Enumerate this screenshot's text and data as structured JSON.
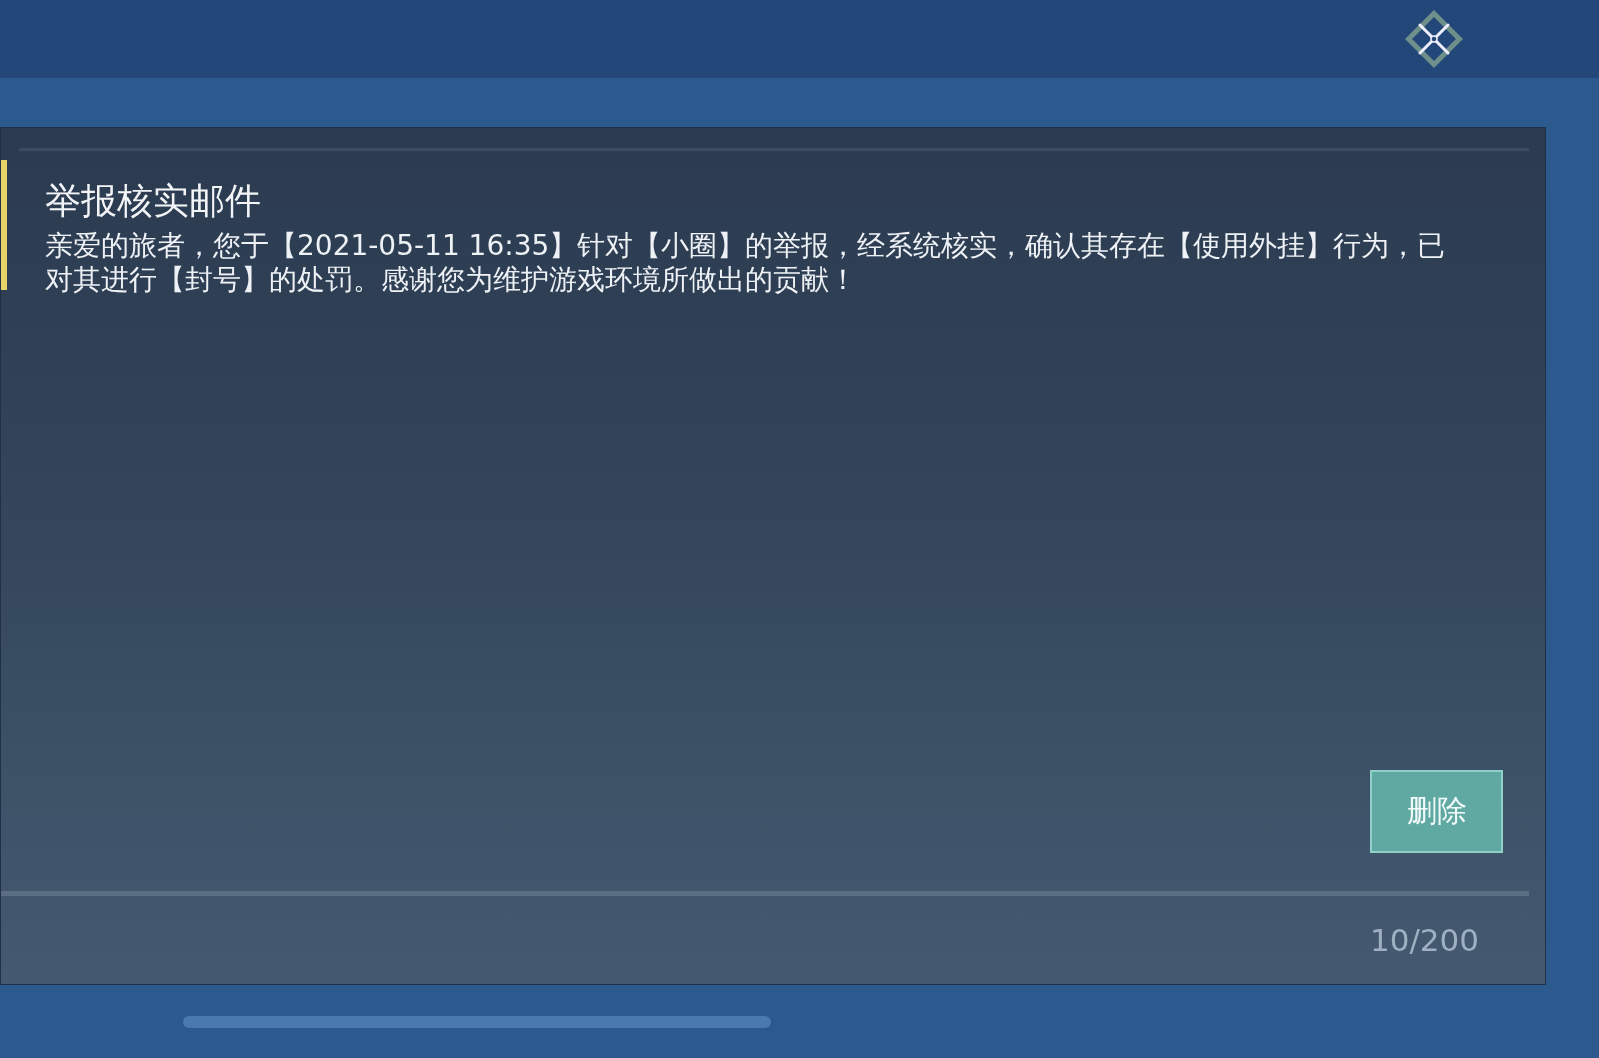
{
  "mail": {
    "title": "举报核实邮件",
    "body": "亲爱的旅者，您于【2021-05-11 16:35】针对【小圈】的举报，经系统核实，确认其存在【使用外挂】行为，已对其进行【封号】的处罚。感谢您为维护游戏环境所做出的贡献！",
    "delete_button": "删除"
  },
  "footer": {
    "count": "10/200"
  }
}
